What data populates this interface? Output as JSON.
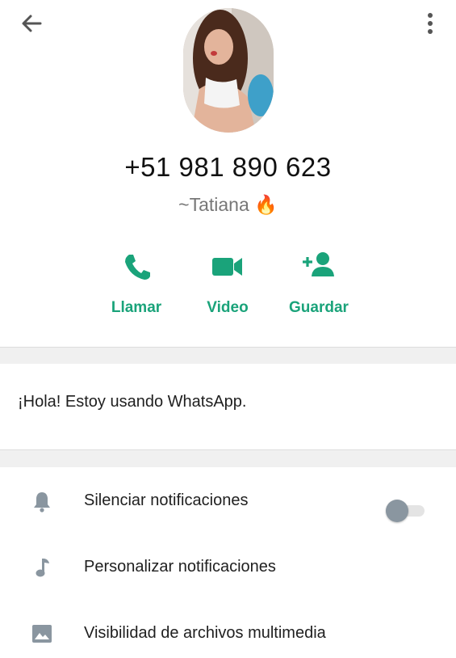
{
  "contact": {
    "phone": "+51 981 890 623",
    "pushname": "~Tatiana 🔥"
  },
  "actions": [
    {
      "label": "Llamar",
      "icon": "phone-icon"
    },
    {
      "label": "Video",
      "icon": "video-camera-icon"
    },
    {
      "label": "Guardar",
      "icon": "add-contact-icon"
    }
  ],
  "about": {
    "text": "¡Hola! Estoy usando WhatsApp."
  },
  "options": [
    {
      "label": "Silenciar notificaciones",
      "icon": "bell-icon",
      "toggle": false
    },
    {
      "label": "Personalizar notificaciones",
      "icon": "music-note-icon"
    },
    {
      "label": "Visibilidad de archivos multimedia",
      "icon": "image-icon"
    }
  ],
  "colors": {
    "accent": "#1aa37a",
    "icons": "#8a96a0",
    "divider": "#f0f0f0"
  }
}
